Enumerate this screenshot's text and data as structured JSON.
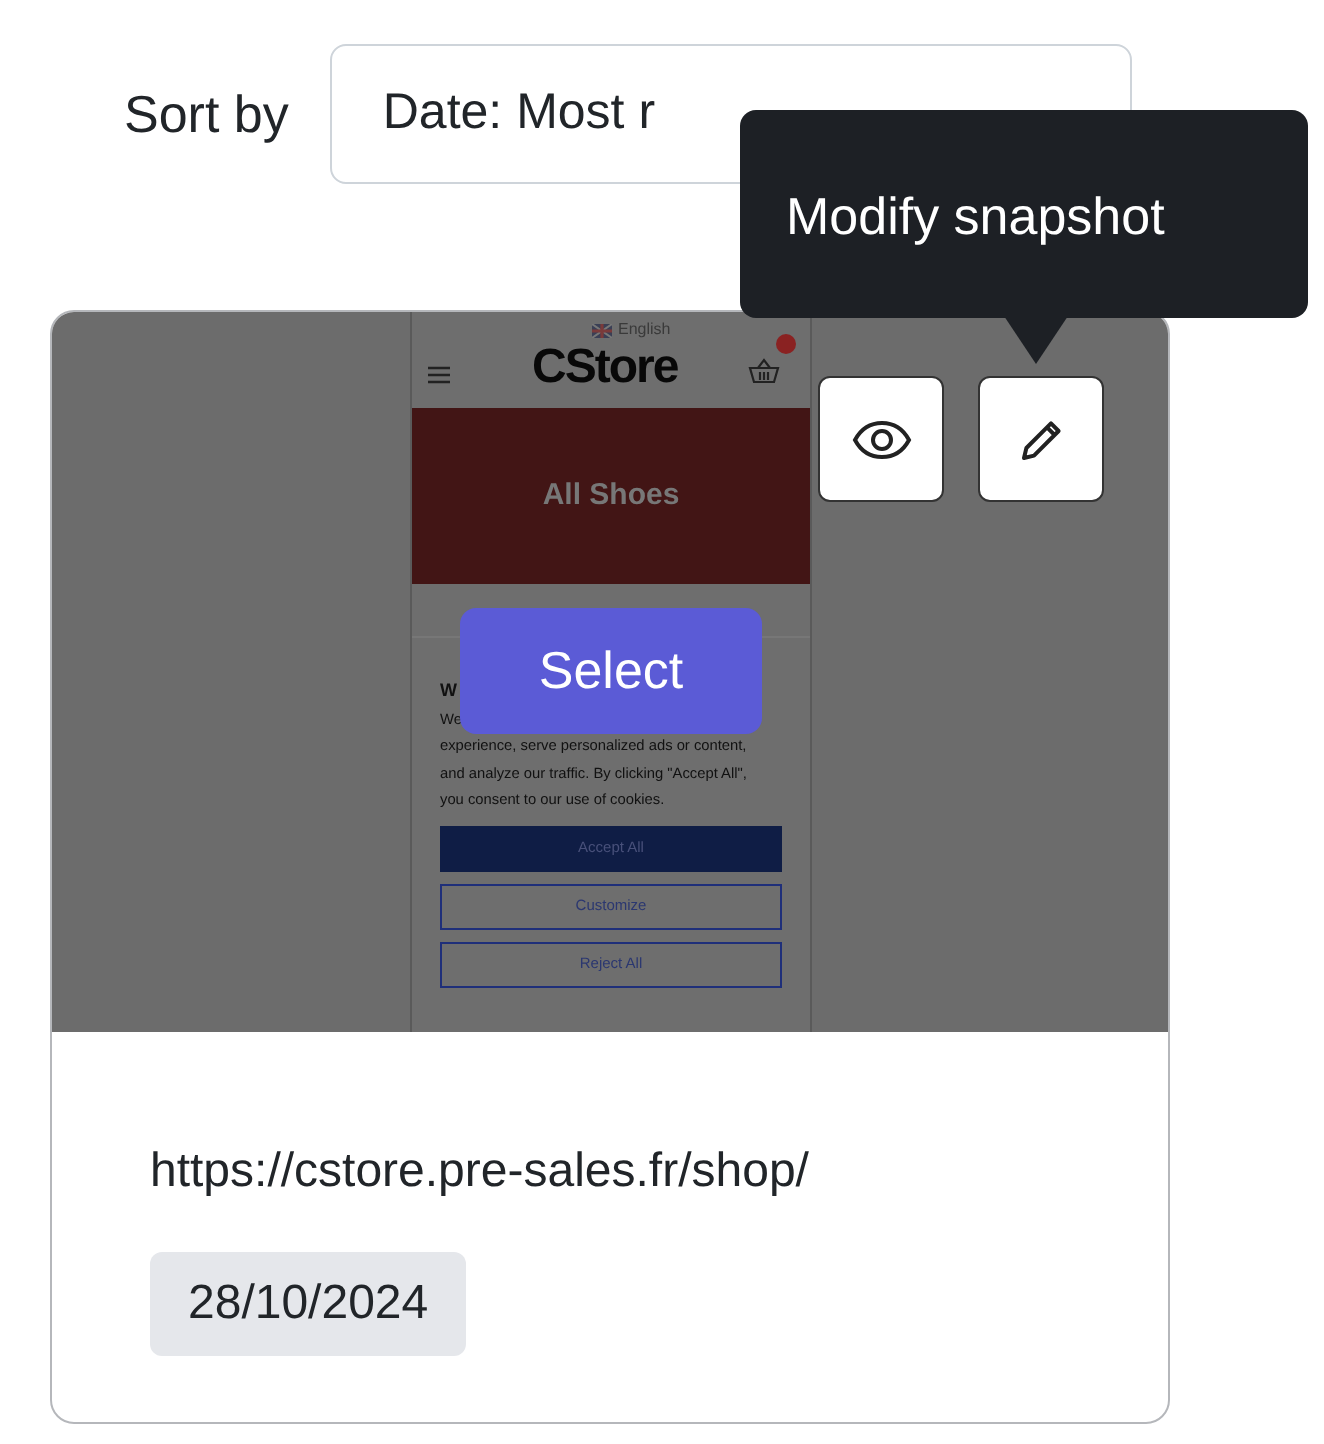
{
  "sort": {
    "label": "Sort by",
    "value": "Date: Most r"
  },
  "tooltip": {
    "text": "Modify snapshot"
  },
  "snapshot": {
    "preview": {
      "language": "English",
      "brand": "CStore",
      "banner": "All Shoes",
      "cookie": {
        "heading": "W",
        "lines": [
          "We",
          "experience, serve personalized ads or content,",
          "and analyze our traffic. By clicking \"Accept All\",",
          "you consent to our use of cookies."
        ],
        "buttons": [
          {
            "label": "Accept All",
            "kind": "filled"
          },
          {
            "label": "Customize",
            "kind": "outline"
          },
          {
            "label": "Reject All",
            "kind": "outline"
          }
        ]
      }
    },
    "select_label": "Select",
    "url": "https://cstore.pre-sales.fr/shop/",
    "date": "28/10/2024"
  }
}
